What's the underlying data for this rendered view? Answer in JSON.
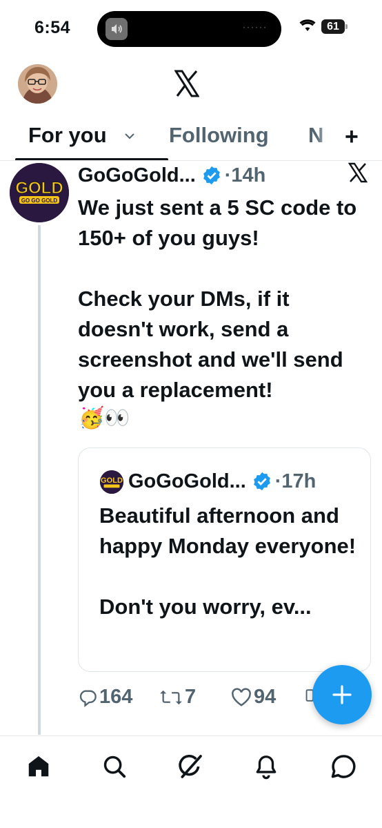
{
  "status_bar": {
    "time": "6:54",
    "battery": "61",
    "island_dots": "······"
  },
  "header": {
    "avatar_icon": "profile-photo",
    "logo_icon": "x-logo-icon"
  },
  "tabs": {
    "for_you": "For you",
    "following": "Following",
    "next": "N",
    "add": "+"
  },
  "tweet": {
    "author": "GoGoGold...",
    "time": "·14h",
    "avatar_text": "GOLD",
    "avatar_subtext": "GO GO GOLD",
    "text": "We just sent a 5 SC code to 150+ of you guys!\n\nCheck your DMs, if it doesn't work, send a screenshot and we'll send you a replacement!",
    "emoji": "🥳👀",
    "quote": {
      "author": "GoGoGold...",
      "time": "·17h",
      "text": "Beautiful afternoon and happy Monday everyone!\n\nDon't you worry, ev..."
    },
    "actions": {
      "replies": "164",
      "reposts": "7",
      "likes": "94"
    }
  },
  "colors": {
    "accent": "#1d9bf0",
    "text": "#0f1419",
    "muted": "#536471"
  },
  "bottom_nav": [
    "home-icon",
    "search-icon",
    "grok-icon",
    "notifications-icon",
    "messages-icon"
  ]
}
